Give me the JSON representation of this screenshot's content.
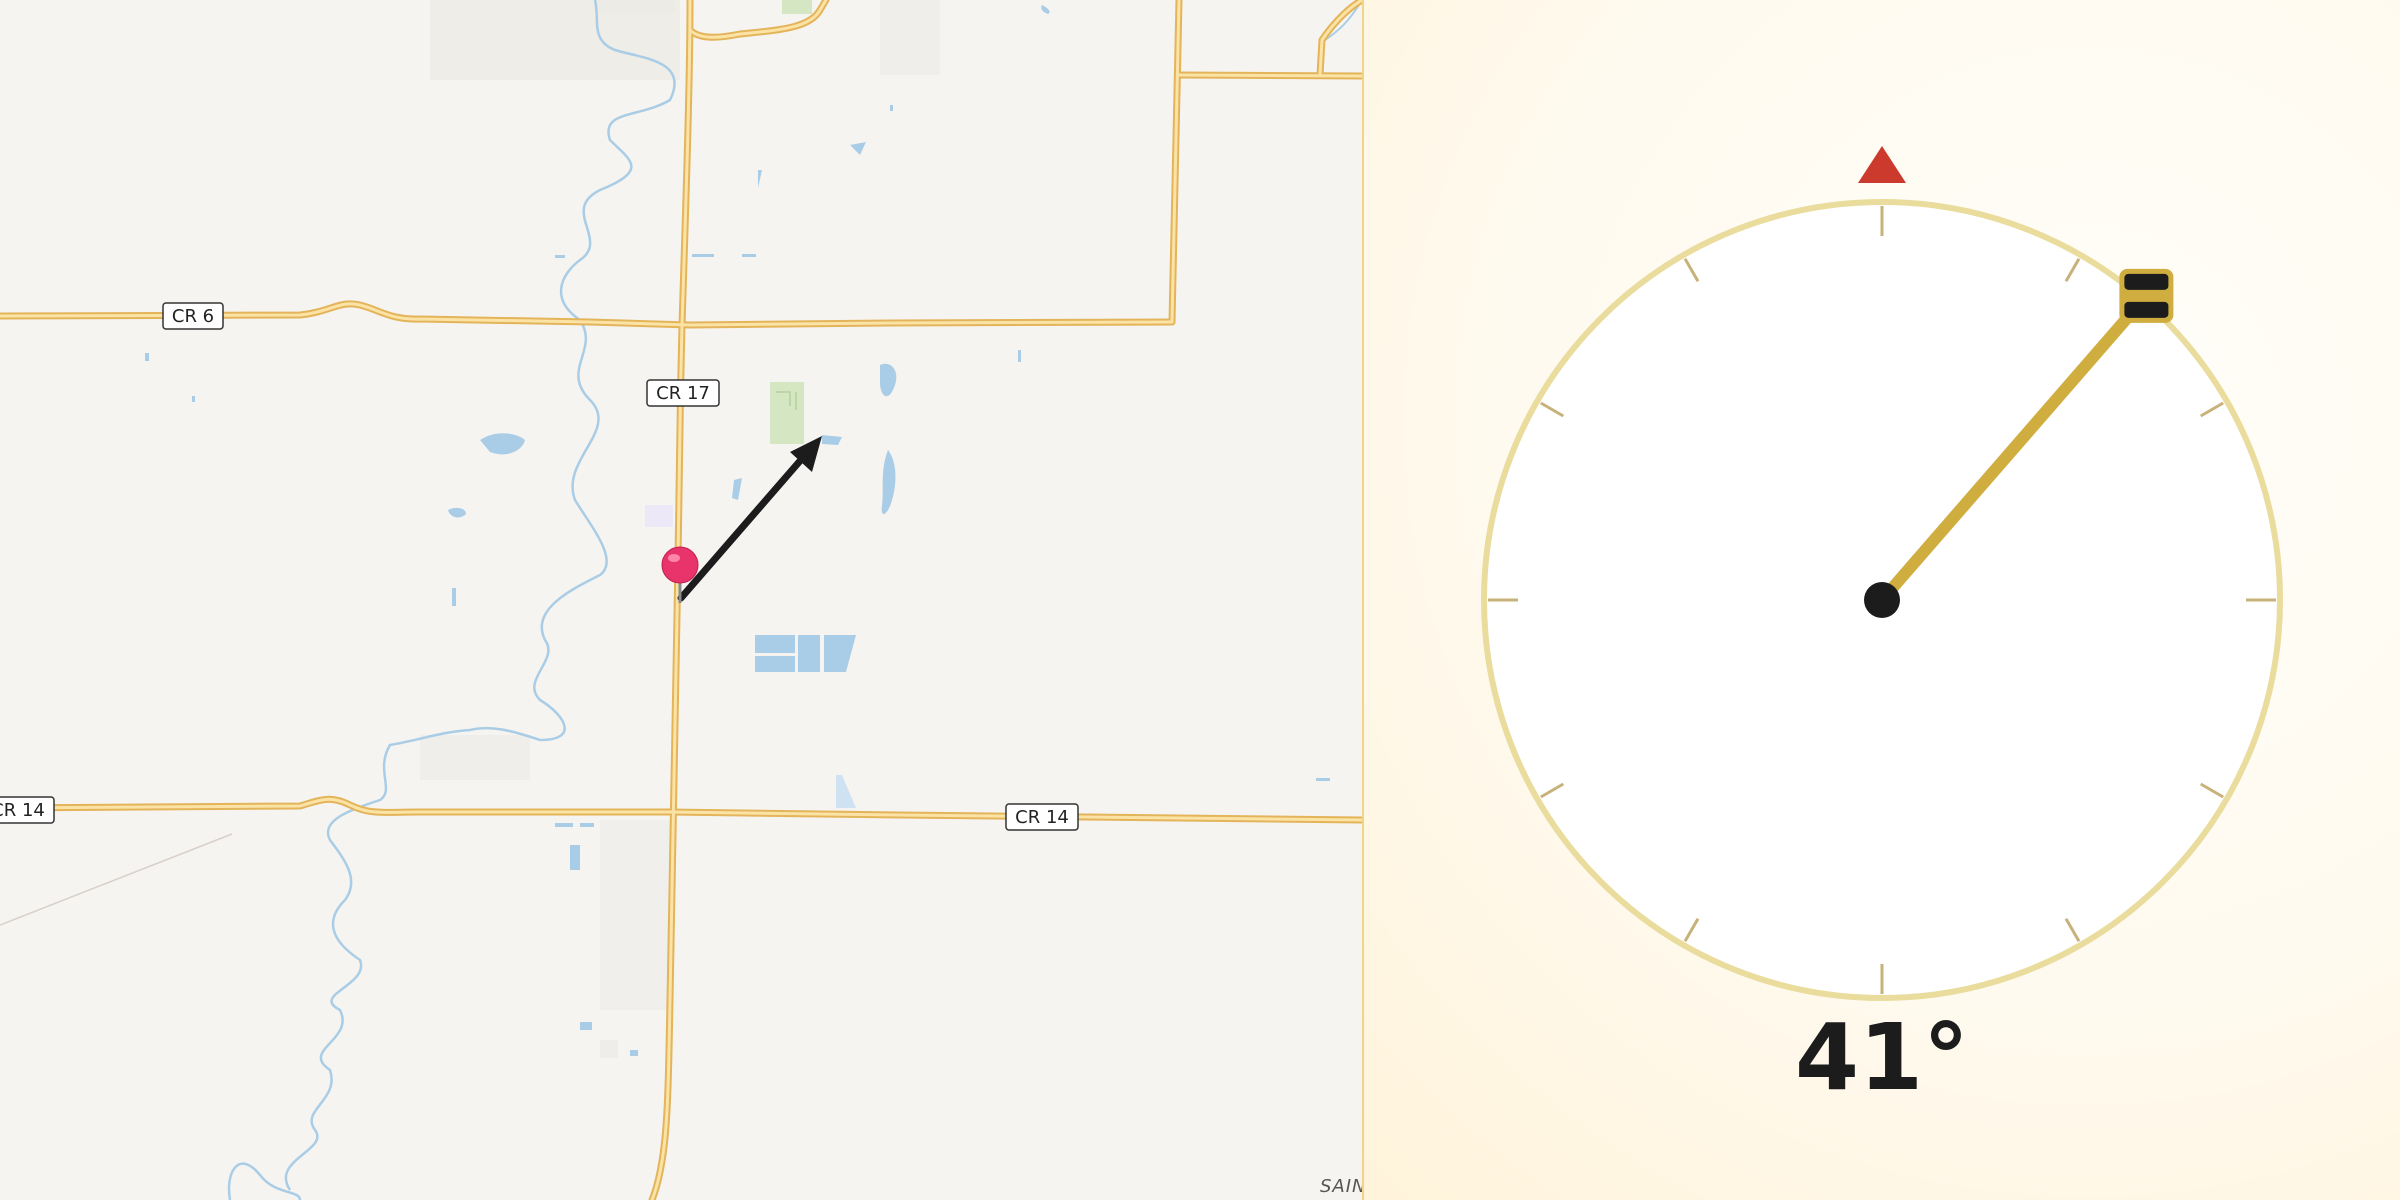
{
  "map": {
    "road_labels": {
      "cr6": "CR 6",
      "cr17": "CR 17",
      "cr14_left": "CR 14",
      "cr14_right": "CR 14"
    },
    "place_label": "SAIN",
    "pin_color": "#e8336b",
    "arrow_color": "#1c1c1c",
    "road_color": "#f2c66a",
    "water_color": "#a9cde6"
  },
  "compass": {
    "heading_deg": 41,
    "heading_text": "41°",
    "north_marker_color": "#cc3a2e",
    "needle_color": "#cfad3f",
    "ring_color": "#e9dc9c"
  }
}
